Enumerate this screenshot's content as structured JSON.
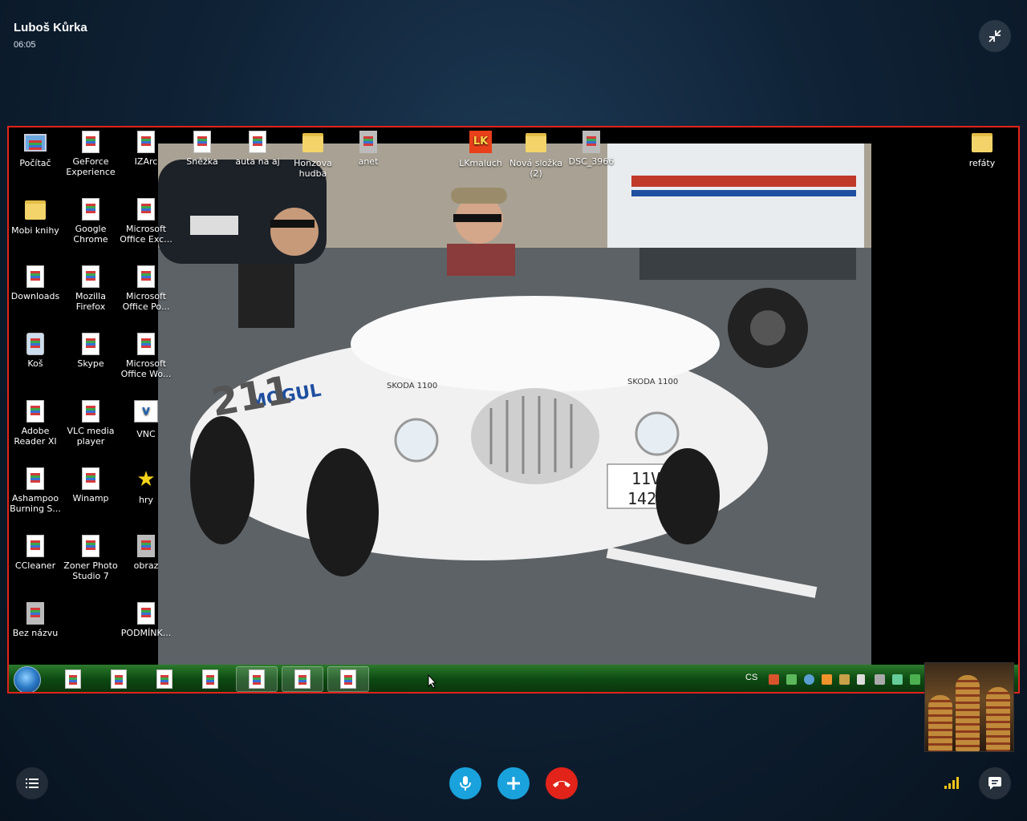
{
  "call": {
    "caller_name": "Luboš Kůrka",
    "duration": "06:05"
  },
  "desktop": {
    "icons": [
      {
        "label": "Počítač",
        "type": "computer"
      },
      {
        "label": "GeForce Experience",
        "type": "doc"
      },
      {
        "label": "IZArc",
        "type": "doc"
      },
      {
        "label": "Sněžka",
        "type": "doc"
      },
      {
        "label": "auta na aj",
        "type": "doc"
      },
      {
        "label": "Honzova hudba",
        "type": "folder"
      },
      {
        "label": "anet",
        "type": "image"
      },
      {
        "label": "LKmaluch",
        "type": "lk"
      },
      {
        "label": "Nová složka (2)",
        "type": "folder"
      },
      {
        "label": "DSC_3966",
        "type": "image"
      },
      {
        "label": "refáty",
        "type": "folder"
      },
      {
        "label": "Mobi knihy",
        "type": "folder"
      },
      {
        "label": "Google Chrome",
        "type": "doc"
      },
      {
        "label": "Microsoft Office Exc...",
        "type": "doc"
      },
      {
        "label": "Downloads",
        "type": "doc"
      },
      {
        "label": "Mozilla Firefox",
        "type": "doc"
      },
      {
        "label": "Microsoft Office Po...",
        "type": "doc"
      },
      {
        "label": "Koš",
        "type": "trash"
      },
      {
        "label": "Skype",
        "type": "doc"
      },
      {
        "label": "Microsoft Office Wo...",
        "type": "doc"
      },
      {
        "label": "Adobe Reader XI",
        "type": "doc"
      },
      {
        "label": "VLC media player",
        "type": "doc"
      },
      {
        "label": "VNC",
        "type": "vnc"
      },
      {
        "label": "Ashampoo Burning S...",
        "type": "doc"
      },
      {
        "label": "Winamp",
        "type": "doc"
      },
      {
        "label": "hry",
        "type": "star"
      },
      {
        "label": "CCleaner",
        "type": "doc"
      },
      {
        "label": "Zoner Photo Studio 7",
        "type": "doc"
      },
      {
        "label": "obraz",
        "type": "image"
      },
      {
        "label": "Bez názvu",
        "type": "image"
      },
      {
        "label": "PODMÍNK...",
        "type": "doc"
      }
    ],
    "photo": {
      "plate": "11V 1428",
      "badge_text": "SKODA 1100",
      "side_text": "MOGUL",
      "race_number": "211"
    },
    "taskbar": {
      "language": "CS",
      "app_count": 7
    }
  },
  "colors": {
    "accent_blue": "#1aa2dc",
    "hangup_red": "#e2231a",
    "share_border": "#e2231a",
    "signal": "#f0c419"
  },
  "icons": {
    "minimize": "minimize-icon",
    "menu": "list-icon",
    "mic": "microphone-icon",
    "add": "plus-icon",
    "hangup": "hang-up-icon",
    "signal": "signal-strength-icon",
    "chat": "chat-icon"
  }
}
